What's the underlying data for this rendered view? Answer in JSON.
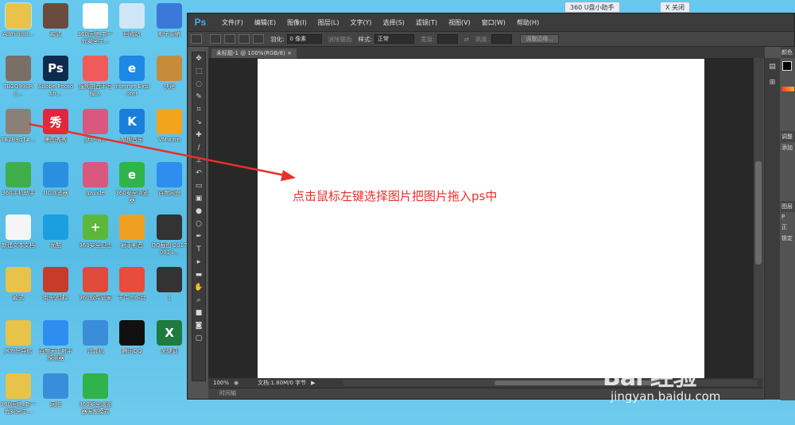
{
  "desktop": {
    "icons": [
      {
        "label": "Administr...",
        "glyph": "",
        "color": "#e8c34a",
        "selected": true
      },
      {
        "label": "款式",
        "glyph": "",
        "color": "#6b4b3e"
      },
      {
        "label": "360压缩_新一代安全主...",
        "glyph": "",
        "color": "#ffffff"
      },
      {
        "label": "回收站",
        "glyph": "",
        "color": "#cfe6f6"
      },
      {
        "label": "影子系统",
        "glyph": "",
        "color": "#3b78d8"
      },
      {
        "label": "TB2Q990Rc...",
        "glyph": "",
        "color": "#7a6f66"
      },
      {
        "label": "Adobe Photosh...",
        "glyph": "Ps",
        "color": "#0d2b4d"
      },
      {
        "label": "搜狗拼音手写输入",
        "glyph": "",
        "color": "#f15a5a"
      },
      {
        "label": "Internet Explorer",
        "glyph": "e",
        "color": "#1e88e5"
      },
      {
        "label": "快递",
        "glyph": "",
        "color": "#c78b3c"
      },
      {
        "label": "TB2B9qT#...",
        "glyph": "",
        "color": "#8b8078"
      },
      {
        "label": "美图秀秀",
        "glyph": "秀",
        "color": "#e2263d"
      },
      {
        "label": "gts--w...",
        "glyph": "",
        "color": "#d9587e"
      },
      {
        "label": "酷狗音乐",
        "glyph": "K",
        "color": "#1a7fdb"
      },
      {
        "label": "VMware",
        "glyph": "",
        "color": "#f3a21b"
      },
      {
        "label": "360手机助手",
        "glyph": "",
        "color": "#3fae49"
      },
      {
        "label": "UC浏览器",
        "glyph": "",
        "color": "#2b8fe0"
      },
      {
        "label": "gavide",
        "glyph": "",
        "color": "#d9587e"
      },
      {
        "label": "360安全浏览器",
        "glyph": "e",
        "color": "#2fb34b"
      },
      {
        "label": "百度网盘",
        "glyph": "",
        "color": "#2d8ef0"
      },
      {
        "label": "新建文本文档",
        "glyph": "",
        "color": "#f5f5f5"
      },
      {
        "label": "优酷",
        "glyph": "",
        "color": "#1aa0e0"
      },
      {
        "label": "360安全卫士",
        "glyph": "+",
        "color": "#5bb83a"
      },
      {
        "label": "射手影音",
        "glyph": "",
        "color": "#f0a020"
      },
      {
        "label": "QQ截图 20170914...",
        "glyph": "",
        "color": "#333333"
      },
      {
        "label": "款式",
        "glyph": "",
        "color": "#e8c34a"
      },
      {
        "label": "街头篮球2",
        "glyph": "",
        "color": "#c83a2a"
      },
      {
        "label": "360软件管家",
        "glyph": "",
        "color": "#e14a3a"
      },
      {
        "label": "千牛工作台",
        "glyph": "",
        "color": "#e94b3c"
      },
      {
        "label": "1",
        "glyph": "",
        "color": "#333333"
      },
      {
        "label": "JK外贸导航",
        "glyph": "",
        "color": "#e8c34a"
      },
      {
        "label": "百度天下射手探测器",
        "glyph": "",
        "color": "#2d8ef0"
      },
      {
        "label": "计算机",
        "glyph": "",
        "color": "#3a8ed9"
      },
      {
        "label": "腾讯QQ",
        "glyph": "",
        "color": "#111111"
      },
      {
        "label": "关键词",
        "glyph": "X",
        "color": "#1f7a3f"
      },
      {
        "label": "360压缩_新一代安全主...",
        "glyph": "",
        "color": "#e8c34a"
      },
      {
        "label": "网络",
        "glyph": "",
        "color": "#3a8ed9"
      },
      {
        "label": "360安全浏览器无痕模式",
        "glyph": "",
        "color": "#2fb34b"
      }
    ],
    "top_tabs": [
      {
        "label": "360 U盘小助手"
      },
      {
        "label": "X 关闭"
      }
    ]
  },
  "ps": {
    "logo": "Ps",
    "menu": [
      "文件(F)",
      "编辑(E)",
      "图像(I)",
      "图层(L)",
      "文字(Y)",
      "选择(S)",
      "滤镜(T)",
      "视图(V)",
      "窗口(W)",
      "帮助(H)"
    ],
    "options": {
      "feather_label": "羽化:",
      "feather_value": "0 像素",
      "antialias_label": "消除锯齿",
      "style_label": "样式:",
      "style_value": "正常",
      "width_label": "宽度:",
      "height_label": "高度:",
      "refine_button": "调整边缘..."
    },
    "doc_tab": "未标题-1 @ 100%(RGB/8) ×",
    "canvas_text": "点击鼠标左键选择图片把图片拖入ps中",
    "status": {
      "zoom": "100%",
      "doc_info": "文档:1.80M/0 字节"
    },
    "timeline": "时间轴",
    "right_panels": {
      "color_label": "颜色",
      "adjust_label": "调整",
      "add_label": "添加",
      "layers_label": "图层",
      "kind_label": "P",
      "normal_label": "正",
      "lock_label": "锁定"
    },
    "colors": {
      "app_bg": "#535353",
      "canvas": "#ffffff",
      "instruction": "#e8302a",
      "logo": "#4aa8e8"
    }
  },
  "watermark": {
    "logo": "Bai 经验",
    "url": "jingyan.baidu.com"
  }
}
